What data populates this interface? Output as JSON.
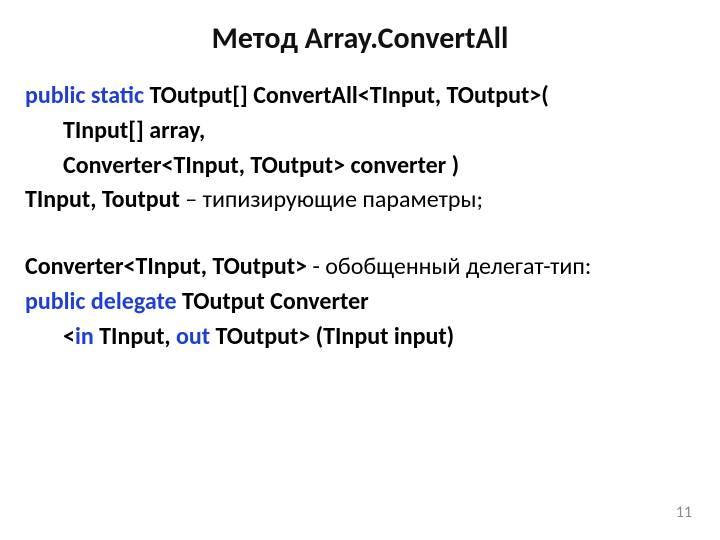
{
  "title": "Метод Array.ConvertAll",
  "lines": {
    "l1": {
      "public_static": "public static",
      "rest": " TOutput[] ConvertAll<TInput, TOutput>("
    },
    "l2": "TInput[] array,",
    "l3": "Converter<TInput, TOutput> converter )",
    "l4": {
      "bold": "TInput, Toutput",
      "rest": " – типизирующие параметры;"
    },
    "l5": {
      "bold": "Converter<TInput, TOutput>",
      "rest": " - обобщенный делегат-тип:"
    },
    "l6": {
      "public": "public",
      "delegate": "delegate",
      "rest": " TOutput Converter"
    },
    "l7": {
      "lt": "<",
      "in": "in",
      "mid": " TInput, ",
      "out": "out",
      "tail": " TOutput> (TInput input)"
    }
  },
  "page_number": "11"
}
